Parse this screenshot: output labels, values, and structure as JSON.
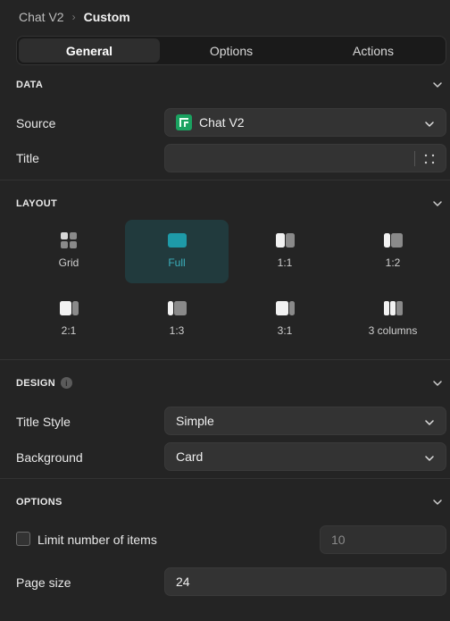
{
  "breadcrumb": {
    "parent": "Chat V2",
    "separator": "›",
    "current": "Custom"
  },
  "tabs": [
    {
      "label": "General",
      "active": true
    },
    {
      "label": "Options",
      "active": false
    },
    {
      "label": "Actions",
      "active": false
    }
  ],
  "data_section": {
    "title": "DATA",
    "source_label": "Source",
    "source_value": "Chat V2",
    "source_icon": "sheets-icon",
    "title_label": "Title",
    "title_value": ""
  },
  "layout_section": {
    "title": "LAYOUT",
    "options": [
      {
        "label": "Grid",
        "selected": false
      },
      {
        "label": "Full",
        "selected": true
      },
      {
        "label": "1:1",
        "selected": false
      },
      {
        "label": "1:2",
        "selected": false
      },
      {
        "label": "2:1",
        "selected": false
      },
      {
        "label": "1:3",
        "selected": false
      },
      {
        "label": "3:1",
        "selected": false
      },
      {
        "label": "3 columns",
        "selected": false
      }
    ]
  },
  "design_section": {
    "title": "DESIGN",
    "title_style_label": "Title Style",
    "title_style_value": "Simple",
    "background_label": "Background",
    "background_value": "Card"
  },
  "options_section": {
    "title": "OPTIONS",
    "limit_label": "Limit number of items",
    "limit_checked": false,
    "limit_value": "10",
    "page_size_label": "Page size",
    "page_size_value": "24"
  },
  "colors": {
    "background": "#242424",
    "accent": "#3bb0bd",
    "selected_bg": "#213a3d",
    "field_bg": "#333333"
  }
}
